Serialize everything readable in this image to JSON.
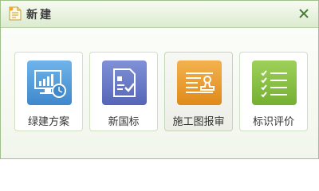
{
  "dialog": {
    "title": "新建",
    "title_icon": "new-document-icon",
    "close_icon": "close-icon"
  },
  "tiles": [
    {
      "label": "绿建方案",
      "icon": "monitor-chart-clock-icon",
      "color": "#4a97d6"
    },
    {
      "label": "新国标",
      "icon": "document-check-icon",
      "color": "#6176c4"
    },
    {
      "label": "施工图报审",
      "icon": "stamp-document-icon",
      "color": "#e89a2c"
    },
    {
      "label": "标识评价",
      "icon": "checklist-icon",
      "color": "#82bd3e"
    }
  ],
  "colors": {
    "titlebar_border": "#9fc08a",
    "close": "#4a7a36"
  }
}
